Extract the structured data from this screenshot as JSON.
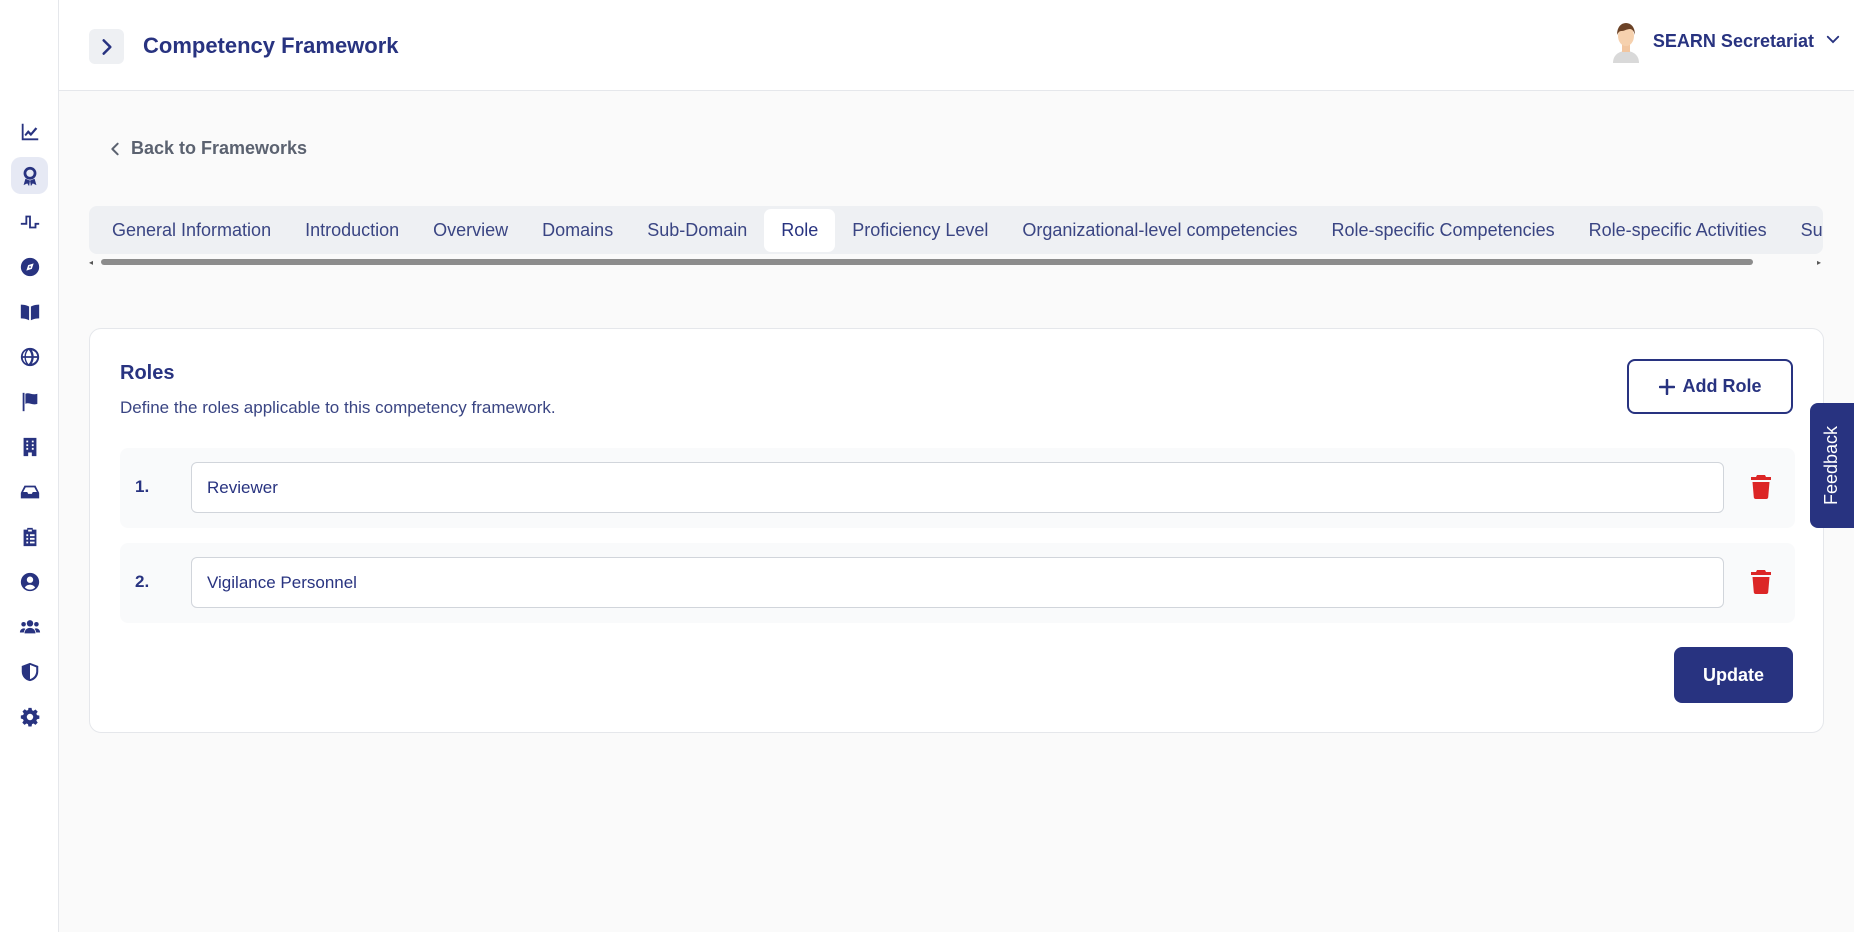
{
  "header": {
    "title": "Competency Framework",
    "user_name": "SEARN Secretariat"
  },
  "sidebar": {
    "items": [
      {
        "icon": "chart-line-icon"
      },
      {
        "icon": "award-icon",
        "active": true
      },
      {
        "icon": "signal-wave-icon"
      },
      {
        "icon": "compass-icon"
      },
      {
        "icon": "book-open-icon"
      },
      {
        "icon": "globe-icon"
      },
      {
        "icon": "flag-icon"
      },
      {
        "icon": "building-icon"
      },
      {
        "icon": "inbox-icon"
      },
      {
        "icon": "clipboard-list-icon"
      },
      {
        "icon": "user-circle-icon"
      },
      {
        "icon": "users-icon"
      },
      {
        "icon": "shield-icon"
      },
      {
        "icon": "gear-icon"
      }
    ]
  },
  "back_link": {
    "label": "Back to Frameworks"
  },
  "tabs": [
    {
      "label": "General Information"
    },
    {
      "label": "Introduction"
    },
    {
      "label": "Overview"
    },
    {
      "label": "Domains"
    },
    {
      "label": "Sub-Domain"
    },
    {
      "label": "Role",
      "active": true
    },
    {
      "label": "Proficiency Level"
    },
    {
      "label": "Organizational-level competencies"
    },
    {
      "label": "Role-specific Competencies"
    },
    {
      "label": "Role-specific Activities"
    },
    {
      "label": "Sugges"
    }
  ],
  "roles_card": {
    "title": "Roles",
    "description": "Define the roles applicable to this competency framework.",
    "add_label": "Add Role",
    "update_label": "Update",
    "roles": [
      {
        "number": "1.",
        "value": "Reviewer"
      },
      {
        "number": "2.",
        "value": "Vigilance Personnel"
      }
    ]
  },
  "feedback": {
    "label": "Feedback"
  },
  "colors": {
    "primary": "#283380",
    "danger": "#dc2626",
    "background": "#fafafa"
  }
}
